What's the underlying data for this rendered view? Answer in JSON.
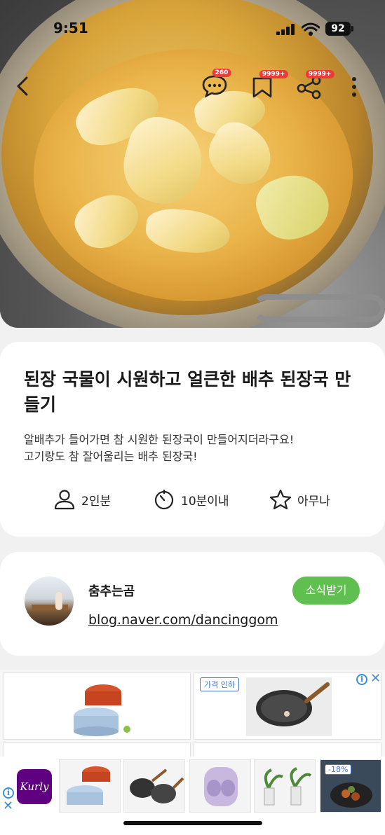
{
  "status_bar": {
    "time": "9:51",
    "battery": "92"
  },
  "top_actions": {
    "comment_count": "260",
    "bookmark_count": "9999+",
    "share_count": "9999+"
  },
  "recipe": {
    "title": "된장 국물이 시원하고 얼큰한 배추 된장국 만들기",
    "description_line1": "알배추가 들어가면 참 시원한 된장국이 만들어지더라구요!",
    "description_line2": "고기랑도 참 잘어울리는 배추 된장국!",
    "servings": "2인분",
    "time": "10분이내",
    "difficulty": "아무나"
  },
  "author": {
    "name": "춤추는곰",
    "link": "blog.naver.com/dancinggom",
    "subscribe_label": "소식받기"
  },
  "ads": {
    "price_drop_label": "가격 인하",
    "brand": "Kurly",
    "discount": "-18%"
  },
  "colors": {
    "accent_green": "#5fbf4f",
    "badge_red": "#ea3b3b",
    "ad_blue": "#3b8fd9",
    "kurly_purple": "#5f0080"
  }
}
